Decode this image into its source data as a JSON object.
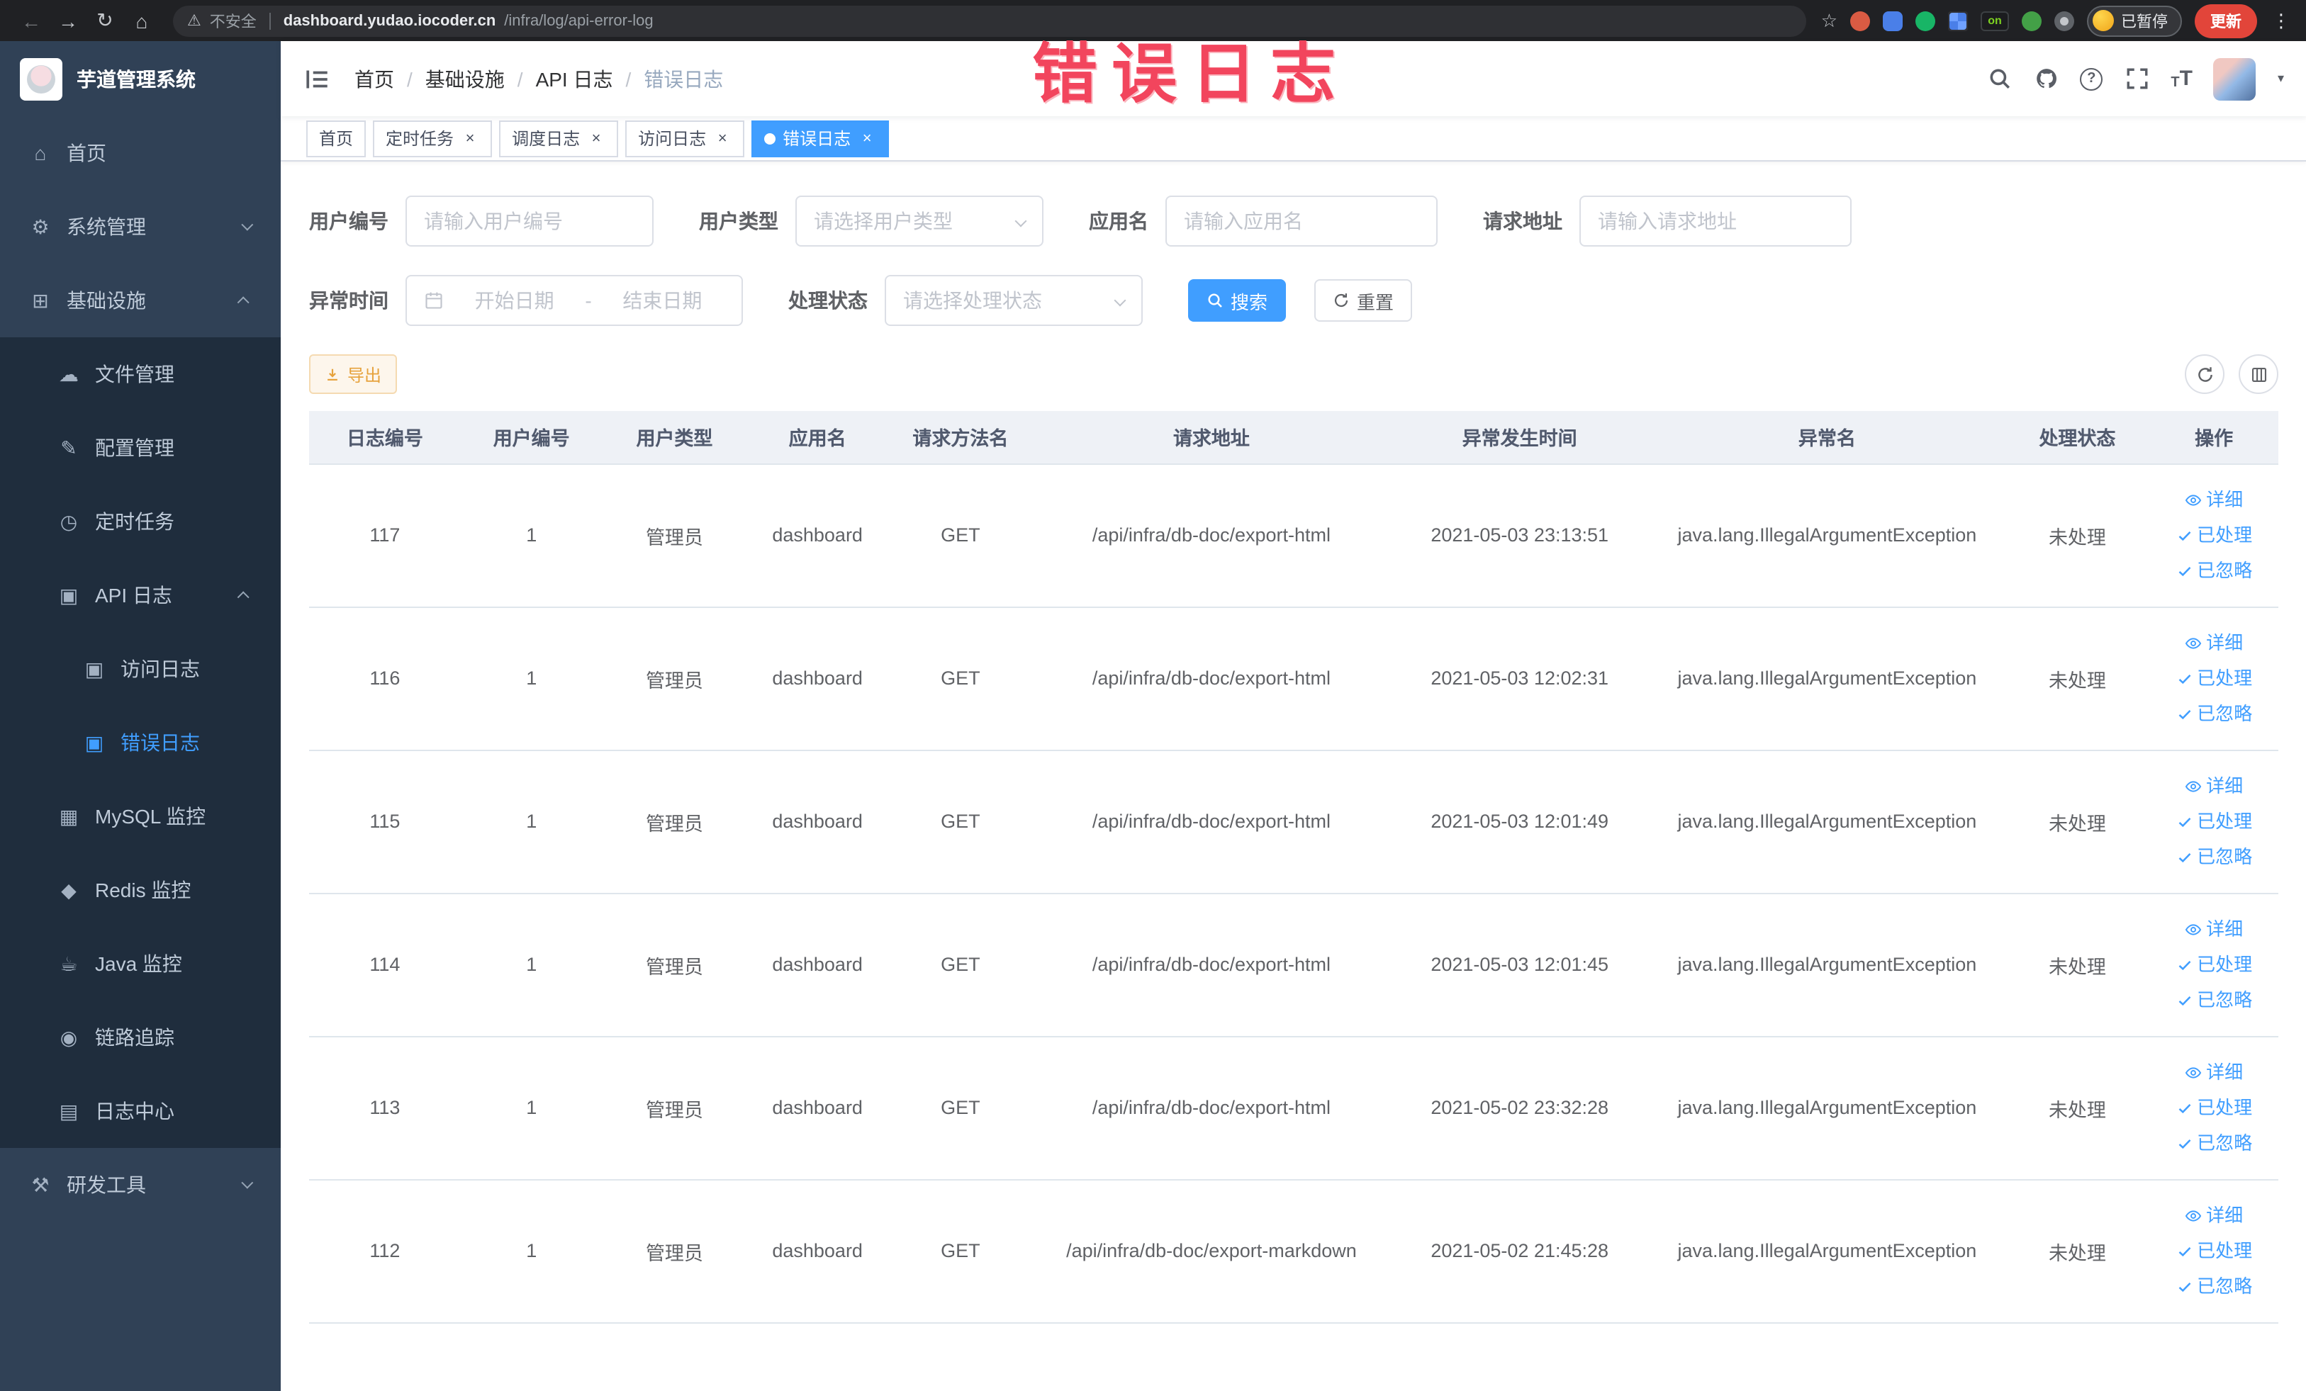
{
  "browser": {
    "security_label": "不安全",
    "url_host": "dashboard.yudao.iocoder.cn",
    "url_path": "/infra/log/api-error-log",
    "ext_badge": "on",
    "paused_label": "已暂停",
    "update_label": "更新"
  },
  "icons": {
    "back": "←",
    "forward": "→",
    "reload": "↻",
    "home_browser": "⌂",
    "warning": "⚠",
    "star": "☆",
    "kebab": "⋮",
    "caret_down": "▾",
    "question": "?",
    "home": "⌂",
    "system": "⚙",
    "infra": "⊞",
    "file": "☁",
    "config": "✎",
    "job": "◷",
    "apilog": "▣",
    "accesslog": "▣",
    "errorlog": "▣",
    "mysql": "▦",
    "redis": "◆",
    "java": "☕",
    "trace": "◉",
    "logcenter": "▤",
    "devtools": "⚒"
  },
  "ui": {
    "close_glyph": "×",
    "breadcrumb_separator": "/",
    "date_separator": "-",
    "tsize_big": "T",
    "tsize_small": "T"
  },
  "sidebar": {
    "logo_title": "芋道管理系统",
    "menu": [
      {
        "label": "首页"
      },
      {
        "label": "系统管理"
      },
      {
        "label": "基础设施"
      },
      {
        "label": "文件管理"
      },
      {
        "label": "配置管理"
      },
      {
        "label": "定时任务"
      },
      {
        "label": "API 日志"
      },
      {
        "label": "访问日志"
      },
      {
        "label": "错误日志"
      },
      {
        "label": "MySQL 监控"
      },
      {
        "label": "Redis 监控"
      },
      {
        "label": "Java 监控"
      },
      {
        "label": "链路追踪"
      },
      {
        "label": "日志中心"
      },
      {
        "label": "研发工具"
      }
    ]
  },
  "header": {
    "breadcrumb": [
      "首页",
      "基础设施",
      "API 日志",
      "错误日志"
    ]
  },
  "watermark": "错误日志",
  "tabs": [
    {
      "label": "首页"
    },
    {
      "label": "定时任务"
    },
    {
      "label": "调度日志"
    },
    {
      "label": "访问日志"
    },
    {
      "label": "错误日志"
    }
  ],
  "filters": {
    "user_id": {
      "label": "用户编号",
      "placeholder": "请输入用户编号"
    },
    "user_type": {
      "label": "用户类型",
      "placeholder": "请选择用户类型"
    },
    "app_name": {
      "label": "应用名",
      "placeholder": "请输入应用名"
    },
    "request_url": {
      "label": "请求地址",
      "placeholder": "请输入请求地址"
    },
    "exception_time": {
      "label": "异常时间",
      "start_placeholder": "开始日期",
      "end_placeholder": "结束日期"
    },
    "process_status": {
      "label": "处理状态",
      "placeholder": "请选择处理状态"
    },
    "search_label": "搜索",
    "reset_label": "重置"
  },
  "toolbar": {
    "export_label": "导出"
  },
  "table": {
    "columns": [
      "日志编号",
      "用户编号",
      "用户类型",
      "应用名",
      "请求方法名",
      "请求地址",
      "异常发生时间",
      "异常名",
      "处理状态",
      "操作"
    ],
    "actions": [
      "详细",
      "已处理",
      "已忽略"
    ],
    "rows": [
      {
        "id": "117",
        "user_id": "1",
        "user_type": "管理员",
        "app": "dashboard",
        "method": "GET",
        "url": "/api/infra/db-doc/export-html",
        "time": "2021-05-03 23:13:51",
        "exception": "java.lang.IllegalArgumentException",
        "status": "未处理"
      },
      {
        "id": "116",
        "user_id": "1",
        "user_type": "管理员",
        "app": "dashboard",
        "method": "GET",
        "url": "/api/infra/db-doc/export-html",
        "time": "2021-05-03 12:02:31",
        "exception": "java.lang.IllegalArgumentException",
        "status": "未处理"
      },
      {
        "id": "115",
        "user_id": "1",
        "user_type": "管理员",
        "app": "dashboard",
        "method": "GET",
        "url": "/api/infra/db-doc/export-html",
        "time": "2021-05-03 12:01:49",
        "exception": "java.lang.IllegalArgumentException",
        "status": "未处理"
      },
      {
        "id": "114",
        "user_id": "1",
        "user_type": "管理员",
        "app": "dashboard",
        "method": "GET",
        "url": "/api/infra/db-doc/export-html",
        "time": "2021-05-03 12:01:45",
        "exception": "java.lang.IllegalArgumentException",
        "status": "未处理"
      },
      {
        "id": "113",
        "user_id": "1",
        "user_type": "管理员",
        "app": "dashboard",
        "method": "GET",
        "url": "/api/infra/db-doc/export-html",
        "time": "2021-05-02 23:32:28",
        "exception": "java.lang.IllegalArgumentException",
        "status": "未处理"
      },
      {
        "id": "112",
        "user_id": "1",
        "user_type": "管理员",
        "app": "dashboard",
        "method": "GET",
        "url": "/api/infra/db-doc/export-markdown",
        "time": "2021-05-02 21:45:28",
        "exception": "java.lang.IllegalArgumentException",
        "status": "未处理"
      }
    ]
  }
}
